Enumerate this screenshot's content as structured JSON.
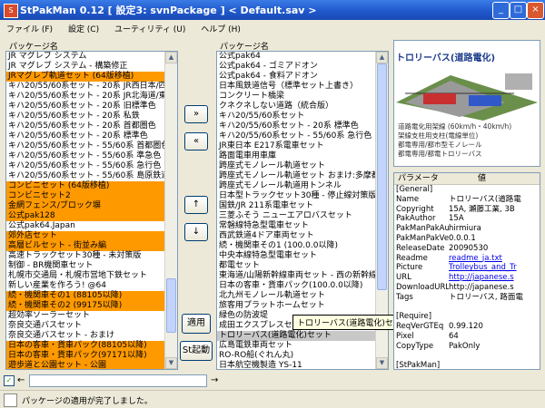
{
  "window": {
    "title": "StPakMan 0.12 [ 設定3: svnPackage ] < Default.sav >",
    "app_icon": "st-icon",
    "minimize": "_",
    "maximize": "□",
    "close": "×"
  },
  "menu": [
    "ファイル (F)",
    "設定 (C)",
    "ユーティリティ (U)",
    "ヘルプ (H)"
  ],
  "left_panel": {
    "header": "パッケージ名",
    "items": [
      {
        "label": "JR マグレブ システム",
        "hl": false
      },
      {
        "label": "JR マグレブ システム - 構築修正",
        "hl": false
      },
      {
        "label": "JRマグレブ軌道セット (64版移植)",
        "hl": true
      },
      {
        "label": "キハ20/55/60系セット - 20系 JR西日本/四国",
        "hl": false
      },
      {
        "label": "キハ20/55/60系セット - 20系 JR北海道/東日",
        "hl": false
      },
      {
        "label": "キハ20/55/60系セット - 20系 旧標準色",
        "hl": false
      },
      {
        "label": "キハ20/55/60系セット - 20系 私鉄",
        "hl": false
      },
      {
        "label": "キハ20/55/60系セット - 20系 首都圏色",
        "hl": false
      },
      {
        "label": "キハ20/55/60系セット - 20系 標準色",
        "hl": false
      },
      {
        "label": "キハ20/55/60系セット - 55/60系 首都圏色",
        "hl": false
      },
      {
        "label": "キハ20/55/60系セット - 55/60系 準急色",
        "hl": false
      },
      {
        "label": "キハ20/55/60系セット - 55/60系 急行色",
        "hl": false
      },
      {
        "label": "キハ20/55/60系セット - 55/60系 島原鉄道",
        "hl": false
      },
      {
        "label": "コンビニセット (64版移植)",
        "hl": true
      },
      {
        "label": "コンビニセット2",
        "hl": true
      },
      {
        "label": "金網フェンス/ブロック塀",
        "hl": true
      },
      {
        "label": "公式pak128",
        "hl": true
      },
      {
        "label": "公式pak64.Japan",
        "hl": false
      },
      {
        "label": "郊外店セット",
        "hl": true
      },
      {
        "label": "高層ビルセット - 街並み編",
        "hl": true
      },
      {
        "label": "高速トラックセット30種 - 未対策版",
        "hl": false
      },
      {
        "label": "制御 - BR機関車セット",
        "hl": false
      },
      {
        "label": "札幌市交通局・札幌市営地下鉄セット",
        "hl": false
      },
      {
        "label": "新しい産業を作ろう! @64",
        "hl": false
      },
      {
        "label": "続・機関車その1 (88105以降)",
        "hl": true
      },
      {
        "label": "続・機関車その2 (99175以降)",
        "hl": true
      },
      {
        "label": "超効率ソーラーセット",
        "hl": false
      },
      {
        "label": "奈良交通バスセット",
        "hl": false
      },
      {
        "label": "奈良交通バスセット - おまけ",
        "hl": false
      },
      {
        "label": "日本の客車・貨車パック(88105以降)",
        "hl": true
      },
      {
        "label": "日本の客車・貨車パック(97171以降)",
        "hl": true
      },
      {
        "label": "遊歩道と公園セット - 公園",
        "hl": true
      },
      {
        "label": "遊歩道と公園セット - 遊歩道",
        "hl": true
      },
      {
        "label": "路線バスセット - 赤",
        "hl": false
      },
      {
        "label": "路線バスセット - 赤",
        "hl": false
      },
      {
        "label": "路線バスセット - 青",
        "hl": false
      }
    ]
  },
  "middle_buttons": {
    "add_all": "»",
    "remove_all": "«",
    "up": "↑",
    "down": "↓",
    "apply": "適用",
    "launch": "St起動"
  },
  "right_panel": {
    "header": "パッケージ名",
    "items": [
      {
        "label": "公式pak64",
        "sel": false
      },
      {
        "label": "公式pak64 - ゴミアドオン",
        "sel": false
      },
      {
        "label": "公式pak64 - 食料アドオン",
        "sel": false
      },
      {
        "label": "日本風鉄道信号（標準セット上書き）",
        "sel": false
      },
      {
        "label": "コンクリート橋梁",
        "sel": false
      },
      {
        "label": "クネクネしない道路（統合版）",
        "sel": false
      },
      {
        "label": "キハ20/55/60系セット",
        "sel": false
      },
      {
        "label": "キハ20/55/60系セット - 20系 標準色",
        "sel": false
      },
      {
        "label": "キハ20/55/60系セット - 55/60系 急行色",
        "sel": false
      },
      {
        "label": "JR東日本 E217系電車セット",
        "sel": false
      },
      {
        "label": "路面電車用車庫",
        "sel": false
      },
      {
        "label": "跨座式モノレール軌道セット",
        "sel": false
      },
      {
        "label": "跨座式モノレール軌道セット おまけ:多摩都市モノレ",
        "sel": false
      },
      {
        "label": "跨座式モノレール軌道用トンネル",
        "sel": false
      },
      {
        "label": "日本型トラックセット30種 - 停止線対策版",
        "sel": false
      },
      {
        "label": "国鉄/JR 211系電車セット",
        "sel": false
      },
      {
        "label": "三菱ふそう ニューエアロバスセット",
        "sel": false
      },
      {
        "label": "常磐線特急型電車セット",
        "sel": false
      },
      {
        "label": "西武鉄道4ドア車両セット",
        "sel": false
      },
      {
        "label": "続・機関車その1 (100.0.0以降)",
        "sel": false
      },
      {
        "label": "中央本線特急型電車セット",
        "sel": false
      },
      {
        "label": "都電セット",
        "sel": false
      },
      {
        "label": "東海道/山陽新幹線車両セット - 西の新幹線セット",
        "sel": false
      },
      {
        "label": "日本の客車・貨車パック(100.0.0以降)",
        "sel": false
      },
      {
        "label": "北九州モノレール軌道セット",
        "sel": false
      },
      {
        "label": "旅客用プラットホームセット",
        "sel": false
      },
      {
        "label": "緑色の防波堤",
        "sel": false
      },
      {
        "label": "成田エクスプレスセット",
        "sel": false
      },
      {
        "label": "トロリーバス(道路電化)セット",
        "sel": true
      },
      {
        "label": "広島電鉄車両セット",
        "sel": false
      },
      {
        "label": "RO-RO船(ぐれん丸)",
        "sel": false
      },
      {
        "label": "日本航空機製造 YS-11",
        "sel": false
      },
      {
        "label": "日本航空機製造 YS-11 国内ロアラインセット",
        "sel": false
      }
    ]
  },
  "tooltip": "トロリーバス(道路電化)セット",
  "preview": {
    "title": "トロリーバス(道路電化)",
    "lines": [
      "道路電化用架線 (60km/h・40km/h)",
      "架線支柱用支柱(電線単位)",
      "都電専用/都市型モノレール",
      "都電専用/都電トロリーバス"
    ]
  },
  "props": {
    "col_param": "パラメータ",
    "col_value": "値",
    "rows": [
      {
        "k": "[General]",
        "v": "",
        "link": false
      },
      {
        "k": "Name",
        "v": "トロリーバス(道路電",
        "link": false
      },
      {
        "k": "Copyright",
        "v": "15A, 瀬藤工業, 3B",
        "link": false
      },
      {
        "k": "PakAuthor",
        "v": "15A",
        "link": false
      },
      {
        "k": "PakManPakAuthor",
        "v": "hirmiura",
        "link": false
      },
      {
        "k": "PakManPakVer",
        "v": "0.0.0.1",
        "link": false
      },
      {
        "k": "ReleaseDate",
        "v": "20090530",
        "link": false
      },
      {
        "k": "Readme",
        "v": "readme_ja.txt",
        "link": true
      },
      {
        "k": "Picture",
        "v": "Trolleybus_and_Tr",
        "link": true
      },
      {
        "k": "URL",
        "v": "http://japanese.s",
        "link": true
      },
      {
        "k": "DownloadURL",
        "v": "http://japanese.s",
        "link": false
      },
      {
        "k": "Tags",
        "v": "トロリーバス, 路面電",
        "link": false
      },
      {
        "k": "",
        "v": "",
        "link": false
      },
      {
        "k": "[Require]",
        "v": "",
        "link": false
      },
      {
        "k": "ReqVerGTEq",
        "v": "0.99.120",
        "link": false
      },
      {
        "k": "Pixel",
        "v": "64",
        "link": false
      },
      {
        "k": "CopyType",
        "v": "PakOnly",
        "link": false
      },
      {
        "k": "",
        "v": "",
        "link": false
      },
      {
        "k": "[StPakMan]",
        "v": "",
        "link": false
      },
      {
        "k": "PositionID",
        "v": "F019E6FBCCFDE",
        "link": false
      },
      {
        "k": "PackageID",
        "v": "38111A8999EBA",
        "link": false
      }
    ]
  },
  "bottom": {
    "nav_left": "←",
    "nav_right": "→",
    "search_value": ""
  },
  "status": {
    "message": "パッケージの適用が完了しました。"
  }
}
